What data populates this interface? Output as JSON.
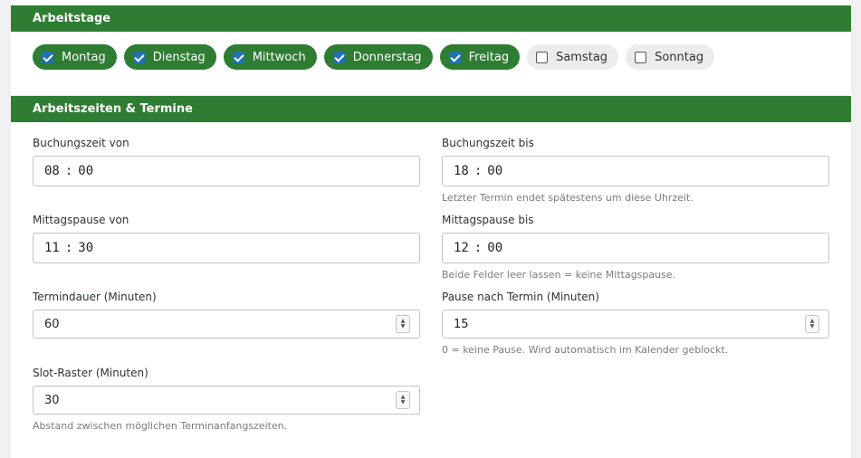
{
  "workdays": {
    "title": "Arbeitstage",
    "days": [
      {
        "label": "Montag",
        "checked": true
      },
      {
        "label": "Dienstag",
        "checked": true
      },
      {
        "label": "Mittwoch",
        "checked": true
      },
      {
        "label": "Donnerstag",
        "checked": true
      },
      {
        "label": "Freitag",
        "checked": true
      },
      {
        "label": "Samstag",
        "checked": false
      },
      {
        "label": "Sonntag",
        "checked": false
      }
    ]
  },
  "schedule": {
    "title": "Arbeitszeiten & Termine",
    "booking_from": {
      "label": "Buchungszeit von",
      "hours": "08",
      "sep": ":",
      "minutes": "00"
    },
    "booking_to": {
      "label": "Buchungszeit bis",
      "hours": "18",
      "sep": ":",
      "minutes": "00",
      "hint": "Letzter Termin endet spätestens um diese Uhrzeit."
    },
    "lunch_from": {
      "label": "Mittagspause von",
      "hours": "11",
      "sep": ":",
      "minutes": "30"
    },
    "lunch_to": {
      "label": "Mittagspause bis",
      "hours": "12",
      "sep": ":",
      "minutes": "00",
      "hint": "Beide Felder leer lassen = keine Mittagspause."
    },
    "duration": {
      "label": "Termindauer (Minuten)",
      "value": "60"
    },
    "pause_after": {
      "label": "Pause nach Termin (Minuten)",
      "value": "15",
      "hint": "0 = keine Pause. Wird automatisch im Kalender geblockt."
    },
    "slot_grid": {
      "label": "Slot-Raster (Minuten)",
      "value": "30",
      "hint": "Abstand zwischen möglichen Terminanfangszeiten."
    }
  },
  "colors": {
    "header": "#2e7d32",
    "checkbox": "#2271b1",
    "pill_off": "#ececec"
  }
}
